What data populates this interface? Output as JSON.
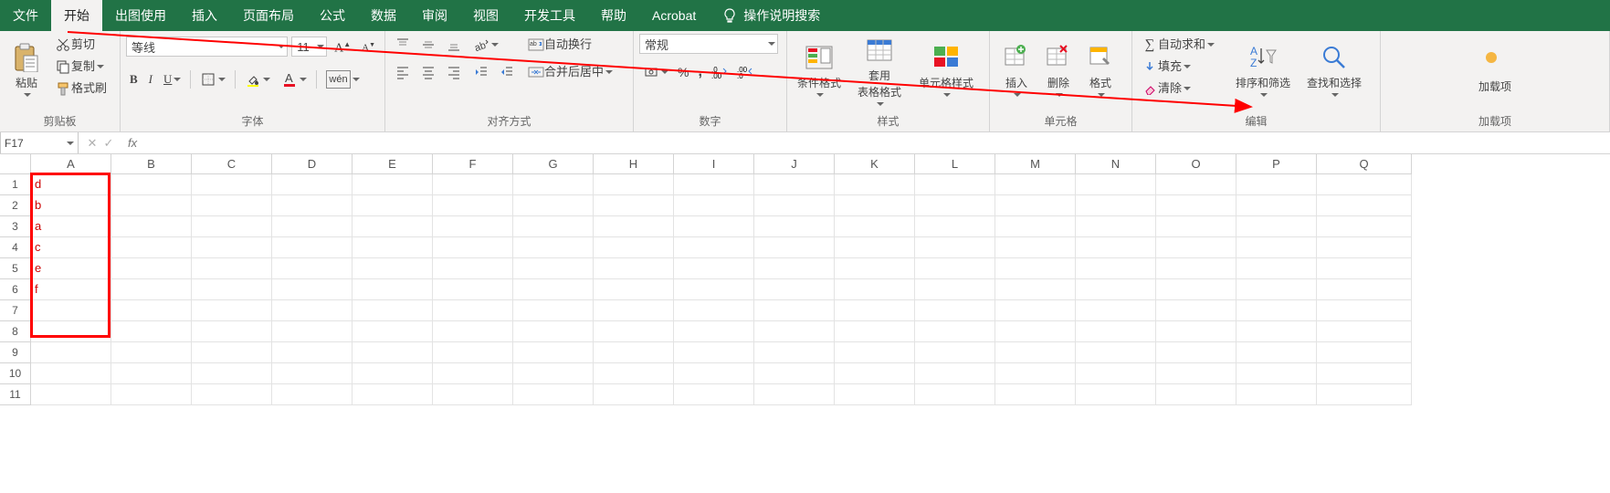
{
  "menu": {
    "tabs": [
      "文件",
      "开始",
      "出图使用",
      "插入",
      "页面布局",
      "公式",
      "数据",
      "审阅",
      "视图",
      "开发工具",
      "帮助",
      "Acrobat"
    ],
    "active_index": 1,
    "tell_me": "操作说明搜索"
  },
  "ribbon": {
    "clipboard": {
      "paste": "粘贴",
      "cut": "剪切",
      "copy": "复制",
      "format_painter": "格式刷",
      "label": "剪贴板"
    },
    "font": {
      "name": "等线",
      "size": "11",
      "wen": "wén",
      "label": "字体"
    },
    "alignment": {
      "wrap": "自动换行",
      "merge": "合并后居中",
      "label": "对齐方式"
    },
    "number": {
      "format": "常规",
      "label": "数字"
    },
    "styles": {
      "cond": "条件格式",
      "table": "套用\n表格格式",
      "cell": "单元格样式",
      "label": "样式"
    },
    "cells": {
      "insert": "插入",
      "delete": "删除",
      "format": "格式",
      "label": "单元格"
    },
    "editing": {
      "autosum": "自动求和",
      "fill": "填充",
      "clear": "清除",
      "sort": "排序和筛选",
      "find": "查找和选择",
      "label": "编辑"
    },
    "addins": {
      "btn": "加载项",
      "label": "加载项"
    }
  },
  "formula_bar": {
    "name_box": "F17",
    "fx": "fx",
    "value": ""
  },
  "grid": {
    "columns": [
      "A",
      "B",
      "C",
      "D",
      "E",
      "F",
      "G",
      "H",
      "I",
      "J",
      "K",
      "L",
      "M",
      "N",
      "O",
      "P",
      "Q"
    ],
    "rows": [
      "1",
      "2",
      "3",
      "4",
      "5",
      "6",
      "7",
      "8",
      "9",
      "10",
      "11"
    ],
    "a_values": [
      "d",
      "b",
      "a",
      "c",
      "e",
      "f"
    ]
  }
}
